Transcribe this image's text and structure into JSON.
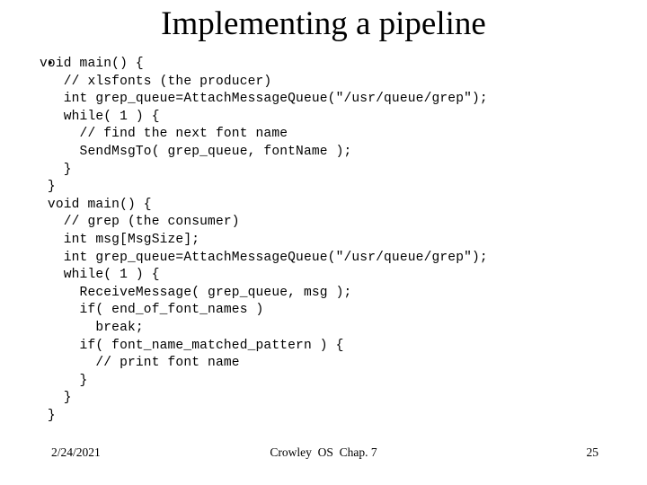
{
  "slide": {
    "title": "Implementing a pipeline",
    "bullet_marker": "•",
    "code_lines": [
      "void main() {",
      "   // xlsfonts (the producer)",
      "   int grep_queue=AttachMessageQueue(\"/usr/queue/grep\");",
      "   while( 1 ) {",
      "     // find the next font name",
      "     SendMsgTo( grep_queue, fontName );",
      "   }",
      " }",
      " void main() {",
      "   // grep (the consumer)",
      "   int msg[MsgSize];",
      "   int grep_queue=AttachMessageQueue(\"/usr/queue/grep\");",
      "   while( 1 ) {",
      "     ReceiveMessage( grep_queue, msg );",
      "     if( end_of_font_names )",
      "       break;",
      "     if( font_name_matched_pattern ) {",
      "       // print font name",
      "     }",
      "   }",
      " }"
    ],
    "footer": {
      "date": "2/24/2021",
      "center": "Crowley  OS  Chap. 7",
      "page_number": "25"
    }
  }
}
